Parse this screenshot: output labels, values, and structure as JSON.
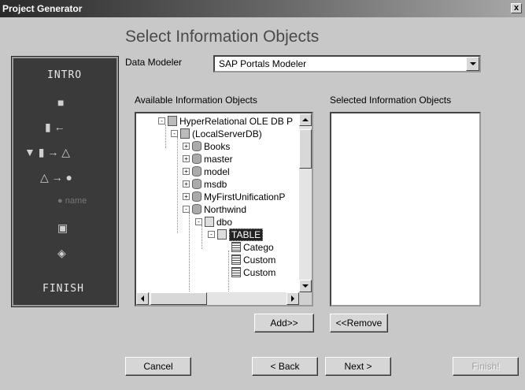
{
  "window": {
    "title": "Project Generator",
    "close": "x"
  },
  "heading": "Select Information Objects",
  "data_modeler": {
    "label": "Data Modeler",
    "value": "SAP Portals Modeler"
  },
  "available_label": "Available Information Objects",
  "selected_label": "Selected Information Objects",
  "wizard": {
    "intro": "INTRO",
    "finish": "FINISH",
    "name_step": "name"
  },
  "tree": {
    "items": [
      {
        "text": "HyperRelational OLE DB P",
        "expander": "-"
      },
      {
        "text": "(LocalServerDB)",
        "expander": "-"
      },
      {
        "text": "Books",
        "expander": "+"
      },
      {
        "text": "master",
        "expander": "+"
      },
      {
        "text": "model",
        "expander": "+"
      },
      {
        "text": "msdb",
        "expander": "+"
      },
      {
        "text": "MyFirstUnificationP",
        "expander": "+"
      },
      {
        "text": "Northwind",
        "expander": "-"
      },
      {
        "text": "dbo",
        "expander": "-"
      },
      {
        "text": "TABLE",
        "expander": "-"
      },
      {
        "text": "Catego"
      },
      {
        "text": "Custom"
      },
      {
        "text": "Custom"
      }
    ]
  },
  "buttons": {
    "add": "Add>>",
    "remove": "<<Remove",
    "cancel": "Cancel",
    "back": "< Back",
    "next": "Next >",
    "finish": "Finish!"
  }
}
